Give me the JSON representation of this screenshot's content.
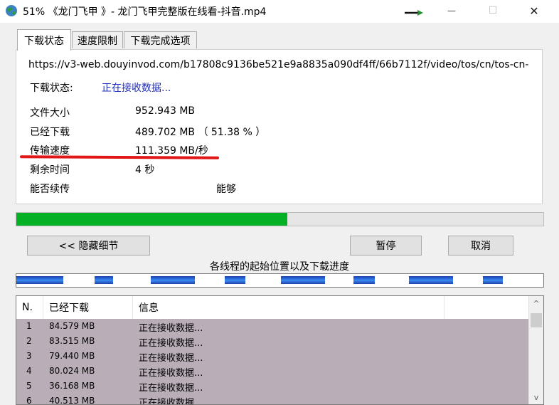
{
  "window": {
    "title": "51% 《龙门飞甲 》- 龙门飞甲完整版在线看-抖音.mp4",
    "minimize_glyph": "—",
    "maximize_glyph": "☐",
    "close_glyph": "✕"
  },
  "tabs": [
    {
      "label": "下载状态",
      "active": true
    },
    {
      "label": "速度限制",
      "active": false
    },
    {
      "label": "下载完成选项",
      "active": false
    }
  ],
  "status_panel": {
    "url": "https://v3-web.douyinvod.com/b17808c9136be521e9a8835a090df4ff/66b7112f/video/tos/cn/tos-cn-",
    "status_label": "下载状态:",
    "status_value": "正在接收数据...",
    "file_size_label": "文件大小",
    "file_size_value": "952.943  MB",
    "downloaded_label": "已经下载",
    "downloaded_value": "489.702  MB （ 51.38 % ）",
    "speed_label": "传输速度",
    "speed_value": "111.359  MB/秒",
    "remaining_label": "剩余时间",
    "remaining_value": "4 秒",
    "resume_label": "能否续传",
    "resume_value": "能够"
  },
  "progress": {
    "percent": 51.38,
    "color": "#06b025"
  },
  "buttons": {
    "hide_details": "<< 隐藏细节",
    "pause": "暂停",
    "cancel": "取消"
  },
  "threads_caption": "各线程的起始位置以及下载进度",
  "thread_segments": [
    {
      "start": 0.0,
      "downloaded": 0.089
    },
    {
      "start": 0.148,
      "downloaded": 0.036
    },
    {
      "start": 0.255,
      "downloaded": 0.084
    },
    {
      "start": 0.395,
      "downloaded": 0.04
    },
    {
      "start": 0.502,
      "downloaded": 0.084
    },
    {
      "start": 0.64,
      "downloaded": 0.04
    },
    {
      "start": 0.745,
      "downloaded": 0.084
    },
    {
      "start": 0.885,
      "downloaded": 0.038
    }
  ],
  "table": {
    "columns": [
      "N.",
      "已经下载",
      "信息"
    ],
    "rows": [
      {
        "n": "1",
        "size": "84.579  MB",
        "info": "正在接收数据..."
      },
      {
        "n": "2",
        "size": "83.515  MB",
        "info": "正在接收数据..."
      },
      {
        "n": "3",
        "size": "79.440  MB",
        "info": "正在接收数据..."
      },
      {
        "n": "4",
        "size": "80.024  MB",
        "info": "正在接收数据..."
      },
      {
        "n": "5",
        "size": "36.168  MB",
        "info": "正在接收数据..."
      },
      {
        "n": "6",
        "size": "40.513  MB",
        "info": "正在接收数据..."
      }
    ]
  },
  "scrollbar": {
    "up_glyph": "^",
    "down_glyph": "v"
  }
}
